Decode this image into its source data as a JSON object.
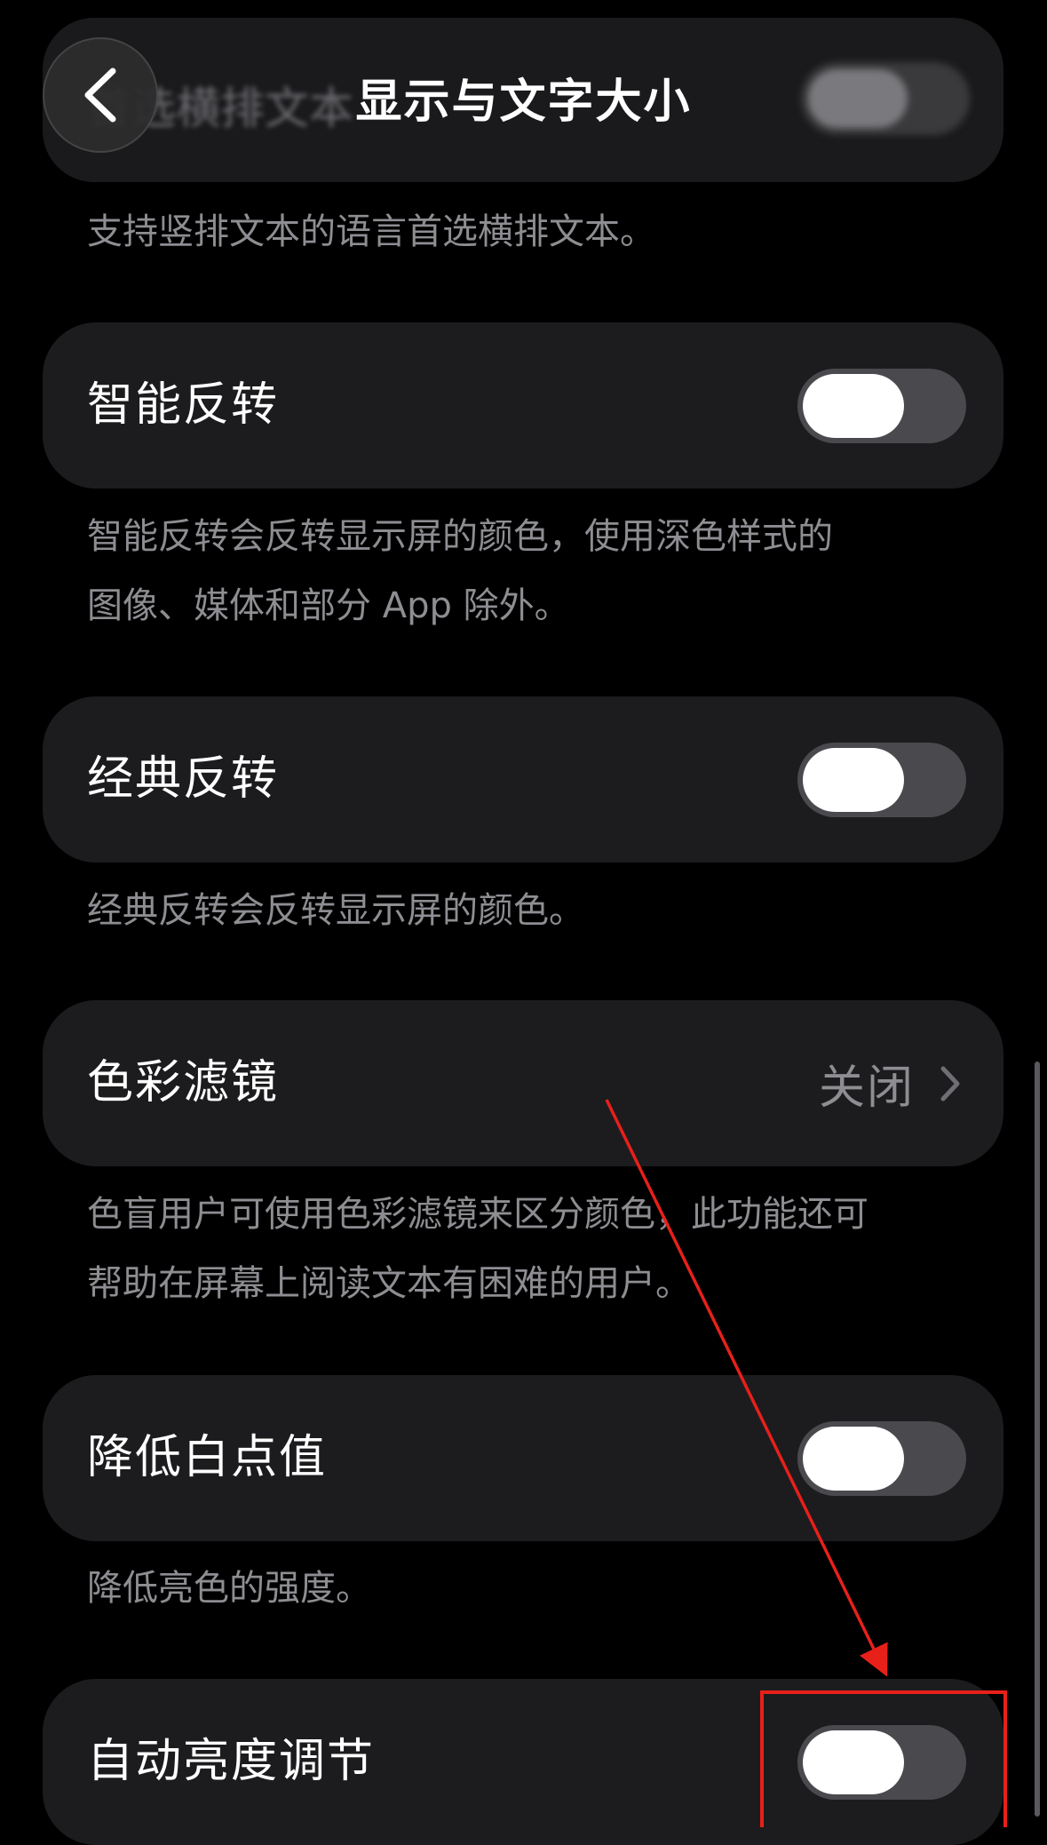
{
  "colors": {
    "background": "#000000",
    "card": "#1c1c1e",
    "footnote_text": "#8d8d92",
    "toggle_off_track": "#4a4a4e",
    "toggle_knob": "#ffffff",
    "annotation": "#e8201a"
  },
  "header": {
    "title": "显示与文字大小",
    "back_icon": "chevron-left-icon"
  },
  "top_partial": {
    "label": "首选横排文本",
    "footnote": "支持竖排文本的语言首选横排文本。"
  },
  "settings": [
    {
      "label": "智能反转",
      "control": "toggle",
      "on": false,
      "footnote_lines": [
        "智能反转会反转显示屏的颜色，使用深色样式的",
        "图像、媒体和部分 App 除外。"
      ]
    },
    {
      "label": "经典反转",
      "control": "toggle",
      "on": false,
      "footnote_lines": [
        "经典反转会反转显示屏的颜色。"
      ]
    },
    {
      "label": "色彩滤镜",
      "control": "disclosure",
      "value": "关闭",
      "chevron_icon": "chevron-right-icon",
      "footnote_lines": [
        "色盲用户可使用色彩滤镜来区分颜色，此功能还可",
        "帮助在屏幕上阅读文本有困难的用户。"
      ]
    },
    {
      "label": "降低白点值",
      "control": "toggle",
      "on": false,
      "footnote_lines": [
        "降低亮色的强度。"
      ]
    },
    {
      "label": "自动亮度调节",
      "control": "toggle",
      "on": false,
      "highlighted": true
    }
  ]
}
